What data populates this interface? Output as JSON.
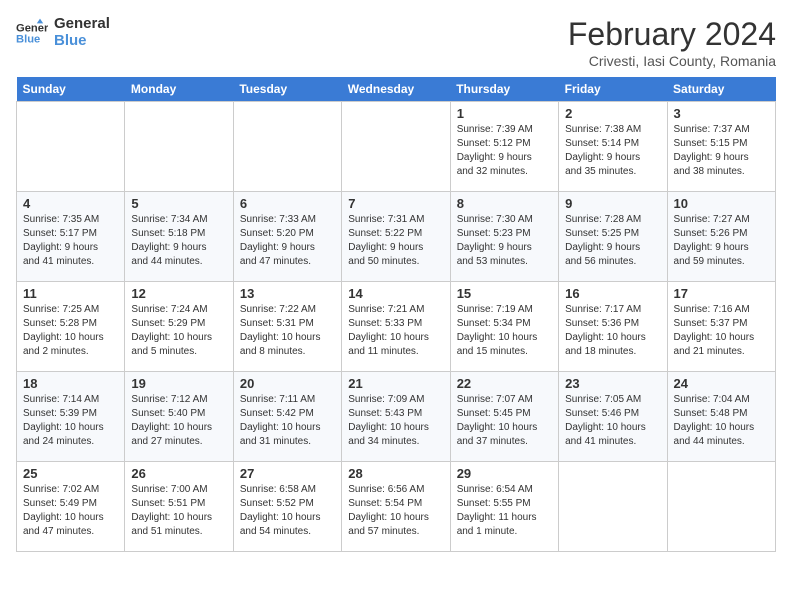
{
  "logo": {
    "name1": "General",
    "name2": "Blue"
  },
  "title": "February 2024",
  "location": "Crivesti, Iasi County, Romania",
  "headers": [
    "Sunday",
    "Monday",
    "Tuesday",
    "Wednesday",
    "Thursday",
    "Friday",
    "Saturday"
  ],
  "weeks": [
    [
      {
        "date": "",
        "info": ""
      },
      {
        "date": "",
        "info": ""
      },
      {
        "date": "",
        "info": ""
      },
      {
        "date": "",
        "info": ""
      },
      {
        "date": "1",
        "info": "Sunrise: 7:39 AM\nSunset: 5:12 PM\nDaylight: 9 hours\nand 32 minutes."
      },
      {
        "date": "2",
        "info": "Sunrise: 7:38 AM\nSunset: 5:14 PM\nDaylight: 9 hours\nand 35 minutes."
      },
      {
        "date": "3",
        "info": "Sunrise: 7:37 AM\nSunset: 5:15 PM\nDaylight: 9 hours\nand 38 minutes."
      }
    ],
    [
      {
        "date": "4",
        "info": "Sunrise: 7:35 AM\nSunset: 5:17 PM\nDaylight: 9 hours\nand 41 minutes."
      },
      {
        "date": "5",
        "info": "Sunrise: 7:34 AM\nSunset: 5:18 PM\nDaylight: 9 hours\nand 44 minutes."
      },
      {
        "date": "6",
        "info": "Sunrise: 7:33 AM\nSunset: 5:20 PM\nDaylight: 9 hours\nand 47 minutes."
      },
      {
        "date": "7",
        "info": "Sunrise: 7:31 AM\nSunset: 5:22 PM\nDaylight: 9 hours\nand 50 minutes."
      },
      {
        "date": "8",
        "info": "Sunrise: 7:30 AM\nSunset: 5:23 PM\nDaylight: 9 hours\nand 53 minutes."
      },
      {
        "date": "9",
        "info": "Sunrise: 7:28 AM\nSunset: 5:25 PM\nDaylight: 9 hours\nand 56 minutes."
      },
      {
        "date": "10",
        "info": "Sunrise: 7:27 AM\nSunset: 5:26 PM\nDaylight: 9 hours\nand 59 minutes."
      }
    ],
    [
      {
        "date": "11",
        "info": "Sunrise: 7:25 AM\nSunset: 5:28 PM\nDaylight: 10 hours\nand 2 minutes."
      },
      {
        "date": "12",
        "info": "Sunrise: 7:24 AM\nSunset: 5:29 PM\nDaylight: 10 hours\nand 5 minutes."
      },
      {
        "date": "13",
        "info": "Sunrise: 7:22 AM\nSunset: 5:31 PM\nDaylight: 10 hours\nand 8 minutes."
      },
      {
        "date": "14",
        "info": "Sunrise: 7:21 AM\nSunset: 5:33 PM\nDaylight: 10 hours\nand 11 minutes."
      },
      {
        "date": "15",
        "info": "Sunrise: 7:19 AM\nSunset: 5:34 PM\nDaylight: 10 hours\nand 15 minutes."
      },
      {
        "date": "16",
        "info": "Sunrise: 7:17 AM\nSunset: 5:36 PM\nDaylight: 10 hours\nand 18 minutes."
      },
      {
        "date": "17",
        "info": "Sunrise: 7:16 AM\nSunset: 5:37 PM\nDaylight: 10 hours\nand 21 minutes."
      }
    ],
    [
      {
        "date": "18",
        "info": "Sunrise: 7:14 AM\nSunset: 5:39 PM\nDaylight: 10 hours\nand 24 minutes."
      },
      {
        "date": "19",
        "info": "Sunrise: 7:12 AM\nSunset: 5:40 PM\nDaylight: 10 hours\nand 27 minutes."
      },
      {
        "date": "20",
        "info": "Sunrise: 7:11 AM\nSunset: 5:42 PM\nDaylight: 10 hours\nand 31 minutes."
      },
      {
        "date": "21",
        "info": "Sunrise: 7:09 AM\nSunset: 5:43 PM\nDaylight: 10 hours\nand 34 minutes."
      },
      {
        "date": "22",
        "info": "Sunrise: 7:07 AM\nSunset: 5:45 PM\nDaylight: 10 hours\nand 37 minutes."
      },
      {
        "date": "23",
        "info": "Sunrise: 7:05 AM\nSunset: 5:46 PM\nDaylight: 10 hours\nand 41 minutes."
      },
      {
        "date": "24",
        "info": "Sunrise: 7:04 AM\nSunset: 5:48 PM\nDaylight: 10 hours\nand 44 minutes."
      }
    ],
    [
      {
        "date": "25",
        "info": "Sunrise: 7:02 AM\nSunset: 5:49 PM\nDaylight: 10 hours\nand 47 minutes."
      },
      {
        "date": "26",
        "info": "Sunrise: 7:00 AM\nSunset: 5:51 PM\nDaylight: 10 hours\nand 51 minutes."
      },
      {
        "date": "27",
        "info": "Sunrise: 6:58 AM\nSunset: 5:52 PM\nDaylight: 10 hours\nand 54 minutes."
      },
      {
        "date": "28",
        "info": "Sunrise: 6:56 AM\nSunset: 5:54 PM\nDaylight: 10 hours\nand 57 minutes."
      },
      {
        "date": "29",
        "info": "Sunrise: 6:54 AM\nSunset: 5:55 PM\nDaylight: 11 hours\nand 1 minute."
      },
      {
        "date": "",
        "info": ""
      },
      {
        "date": "",
        "info": ""
      }
    ]
  ]
}
